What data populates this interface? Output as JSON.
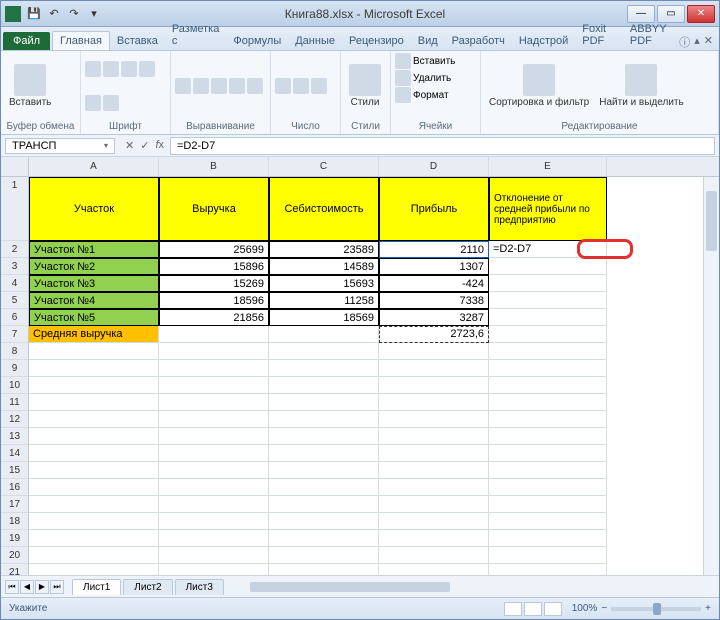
{
  "title": "Книга88.xlsx - Microsoft Excel",
  "tabs": {
    "file": "Файл",
    "list": [
      "Главная",
      "Вставка",
      "Разметка с",
      "Формулы",
      "Данные",
      "Рецензиро",
      "Вид",
      "Разработч",
      "Надстрой",
      "Foxit PDF",
      "ABBYY PDF"
    ]
  },
  "ribbon": {
    "clipboard": {
      "label": "Буфер обмена",
      "paste": "Вставить"
    },
    "font": {
      "label": "Шрифт"
    },
    "align": {
      "label": "Выравнивание"
    },
    "number": {
      "label": "Число"
    },
    "styles": {
      "label": "Стили",
      "btn": "Стили"
    },
    "cells": {
      "label": "Ячейки",
      "insert": "Вставить",
      "delete": "Удалить",
      "format": "Формат"
    },
    "editing": {
      "label": "Редактирование",
      "sort": "Сортировка и фильтр",
      "find": "Найти и выделить"
    }
  },
  "namebox": "ТРАНСП",
  "formula": "=D2-D7",
  "columns": [
    "A",
    "B",
    "C",
    "D",
    "E"
  ],
  "header_row": [
    "Участок",
    "Выручка",
    "Себистоимость",
    "Прибыль",
    "Отклонение от средней прибыли по предприятию"
  ],
  "rows": [
    {
      "n": 2,
      "a": "Участок №1",
      "b": "25699",
      "c": "23589",
      "d": "2110",
      "e": "=D2-D7"
    },
    {
      "n": 3,
      "a": "Участок №2",
      "b": "15896",
      "c": "14589",
      "d": "1307",
      "e": ""
    },
    {
      "n": 4,
      "a": "Участок №3",
      "b": "15269",
      "c": "15693",
      "d": "-424",
      "e": ""
    },
    {
      "n": 5,
      "a": "Участок №4",
      "b": "18596",
      "c": "11258",
      "d": "7338",
      "e": ""
    },
    {
      "n": 6,
      "a": "Участок №5",
      "b": "21856",
      "c": "18569",
      "d": "3287",
      "e": ""
    },
    {
      "n": 7,
      "a": "Средняя выручка",
      "b": "",
      "c": "",
      "d": "2723,6",
      "e": ""
    }
  ],
  "empty_rows": [
    8,
    9,
    10,
    11,
    12,
    13,
    14,
    15,
    16,
    17,
    18,
    19,
    20,
    21
  ],
  "sheets": [
    "Лист1",
    "Лист2",
    "Лист3"
  ],
  "status": "Укажите",
  "zoom": "100%"
}
